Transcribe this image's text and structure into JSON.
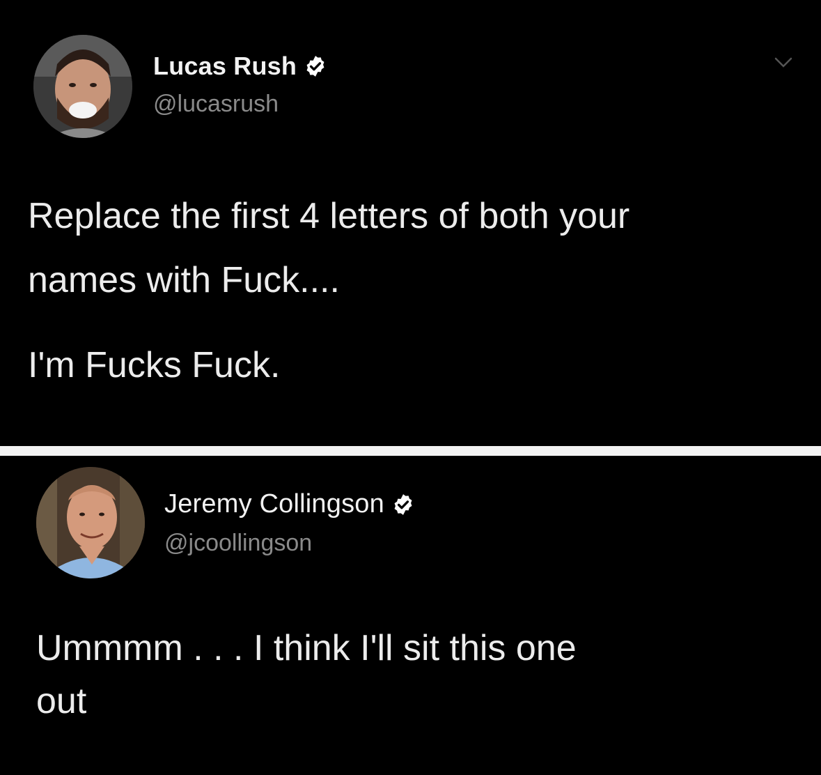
{
  "tweets": [
    {
      "author": {
        "name": "Lucas Rush",
        "handle": "@lucasrush",
        "verified": true,
        "avatar_icon": "avatar-photo-bearded-man"
      },
      "text_lines": [
        "Replace the first 4 letters of both your",
        "names with Fuck....",
        "I'm Fucks Fuck."
      ],
      "menu_icon": "chevron-down-icon"
    },
    {
      "author": {
        "name": "Jeremy Collingson",
        "handle": "@jcoollingson",
        "verified": true,
        "avatar_icon": "avatar-photo-man-blue-shirt"
      },
      "text_lines": [
        "Ummmm . . . I think I'll sit this one",
        "out"
      ]
    }
  ],
  "colors": {
    "background": "#000000",
    "divider": "#f2f2f2",
    "name": "#f2f2f2",
    "handle": "#8a8a8a",
    "text": "#ececec",
    "verified_badge": "#ffffff"
  }
}
